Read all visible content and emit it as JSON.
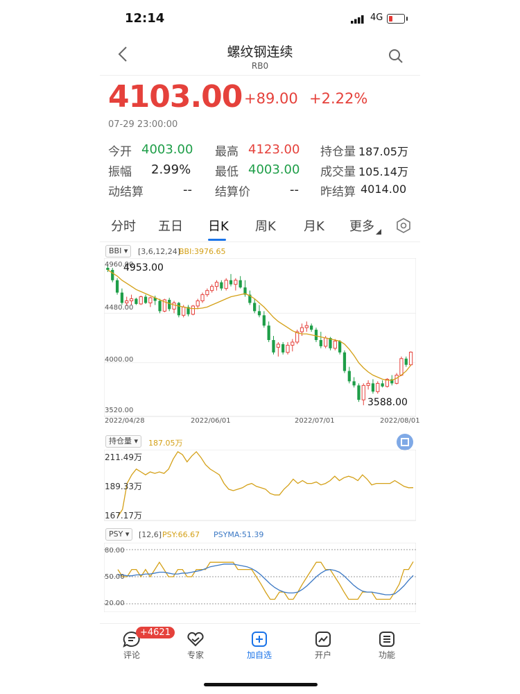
{
  "status_bar": {
    "time": "12:14",
    "network": "4G"
  },
  "header": {
    "title": "螺纹钢连续",
    "code": "RB0"
  },
  "quote": {
    "price": "4103.00",
    "change": "+89.00",
    "change_pct": "+2.22%",
    "timestamp": "07-29 23:00:00"
  },
  "stats": [
    {
      "label": "今开",
      "value": "4003.00",
      "color": "#1e9e48"
    },
    {
      "label": "最高",
      "value": "4123.00",
      "color": "#e5413b"
    },
    {
      "label": "持仓量",
      "value": "187.05万",
      "color": "#222222"
    },
    {
      "label": "振幅",
      "value": "2.99%",
      "color": "#222222"
    },
    {
      "label": "最低",
      "value": "4003.00",
      "color": "#1e9e48"
    },
    {
      "label": "成交量",
      "value": "105.14万",
      "color": "#222222"
    },
    {
      "label": "动结算",
      "value": "--",
      "color": "#222222"
    },
    {
      "label": "结算价",
      "value": "--",
      "color": "#222222"
    },
    {
      "label": "昨结算",
      "value": "4014.00",
      "color": "#222222"
    }
  ],
  "tabs": [
    "分时",
    "五日",
    "日K",
    "周K",
    "月K",
    "更多"
  ],
  "active_tab": "日K",
  "colors": {
    "up": "#e5413b",
    "down": "#1e9e48",
    "bbi": "#d4a017",
    "psyma": "#3b78c4",
    "accent": "#1a73e8"
  },
  "kline": {
    "indicator": "BBI",
    "params": "[3,6,12,24]",
    "indicator_value": "BBI:3976.65",
    "high_label": "4953.00",
    "low_label": "3588.00",
    "y_ticks": [
      "4960.00",
      "4480.00",
      "4000.00",
      "3520.00"
    ],
    "x_ticks": [
      "2022/04/28",
      "2022/06/01",
      "2022/07/01",
      "2022/08/01"
    ]
  },
  "oi_panel": {
    "indicator": "持仓量",
    "value": "187.05万",
    "y_ticks": [
      "211.49万",
      "189.33万",
      "167.17万"
    ]
  },
  "psy_panel": {
    "indicator": "PSY",
    "params": "[12,6]",
    "psy_value": "PSY:66.67",
    "psyma_value": "PSYMA:51.39",
    "y_ticks": [
      "80.00",
      "50.00",
      "20.00"
    ]
  },
  "chart_data": [
    {
      "type": "candlestick",
      "title": "BBI",
      "ylim": [
        3520,
        4960
      ],
      "x_ticks": [
        "2022/04/28",
        "2022/06/01",
        "2022/07/01",
        "2022/08/01"
      ],
      "ohlc": [
        [
          4920,
          4953,
          4880,
          4900
        ],
        [
          4900,
          4920,
          4780,
          4800
        ],
        [
          4800,
          4820,
          4660,
          4680
        ],
        [
          4680,
          4720,
          4560,
          4580
        ],
        [
          4580,
          4640,
          4550,
          4600
        ],
        [
          4600,
          4660,
          4560,
          4620
        ],
        [
          4620,
          4630,
          4560,
          4570
        ],
        [
          4570,
          4650,
          4560,
          4640
        ],
        [
          4640,
          4660,
          4570,
          4580
        ],
        [
          4580,
          4640,
          4540,
          4630
        ],
        [
          4630,
          4650,
          4560,
          4600
        ],
        [
          4600,
          4620,
          4480,
          4500
        ],
        [
          4500,
          4620,
          4490,
          4610
        ],
        [
          4610,
          4630,
          4500,
          4520
        ],
        [
          4520,
          4600,
          4480,
          4580
        ],
        [
          4580,
          4590,
          4440,
          4460
        ],
        [
          4460,
          4560,
          4440,
          4540
        ],
        [
          4540,
          4560,
          4450,
          4470
        ],
        [
          4470,
          4560,
          4460,
          4550
        ],
        [
          4550,
          4620,
          4520,
          4600
        ],
        [
          4600,
          4680,
          4580,
          4660
        ],
        [
          4660,
          4720,
          4640,
          4700
        ],
        [
          4700,
          4760,
          4680,
          4740
        ],
        [
          4740,
          4800,
          4700,
          4780
        ],
        [
          4780,
          4800,
          4700,
          4720
        ],
        [
          4720,
          4820,
          4700,
          4800
        ],
        [
          4800,
          4860,
          4740,
          4760
        ],
        [
          4760,
          4820,
          4700,
          4800
        ],
        [
          4800,
          4840,
          4720,
          4730
        ],
        [
          4730,
          4800,
          4640,
          4660
        ],
        [
          4660,
          4700,
          4560,
          4580
        ],
        [
          4580,
          4620,
          4480,
          4500
        ],
        [
          4500,
          4560,
          4440,
          4460
        ],
        [
          4460,
          4500,
          4340,
          4360
        ],
        [
          4360,
          4400,
          4200,
          4220
        ],
        [
          4220,
          4260,
          4080,
          4100
        ],
        [
          4150,
          4200,
          4060,
          4180
        ],
        [
          4180,
          4200,
          4080,
          4100
        ],
        [
          4100,
          4200,
          4080,
          4170
        ],
        [
          4170,
          4230,
          4110,
          4200
        ],
        [
          4200,
          4320,
          4180,
          4300
        ],
        [
          4300,
          4380,
          4260,
          4340
        ],
        [
          4340,
          4400,
          4300,
          4360
        ],
        [
          4360,
          4380,
          4300,
          4320
        ],
        [
          4320,
          4340,
          4200,
          4220
        ],
        [
          4220,
          4300,
          4140,
          4160
        ],
        [
          4160,
          4260,
          4140,
          4240
        ],
        [
          4240,
          4250,
          4120,
          4140
        ],
        [
          4140,
          4230,
          4120,
          4210
        ],
        [
          4210,
          4220,
          4080,
          4100
        ],
        [
          4100,
          4120,
          3900,
          3920
        ],
        [
          3920,
          3960,
          3800,
          3820
        ],
        [
          3820,
          3860,
          3760,
          3780
        ],
        [
          3780,
          3800,
          3620,
          3640
        ],
        [
          3640,
          3800,
          3588,
          3780
        ],
        [
          3780,
          3830,
          3740,
          3800
        ],
        [
          3800,
          3840,
          3700,
          3720
        ],
        [
          3720,
          3820,
          3700,
          3800
        ],
        [
          3800,
          3830,
          3760,
          3770
        ],
        [
          3770,
          3850,
          3760,
          3840
        ],
        [
          3840,
          3880,
          3780,
          3800
        ],
        [
          3800,
          3900,
          3790,
          3880
        ],
        [
          3880,
          4060,
          3870,
          4040
        ],
        [
          4040,
          4060,
          3960,
          3980
        ],
        [
          3980,
          4110,
          3970,
          4103
        ]
      ],
      "bbi": [
        4900,
        4870,
        4840,
        4800,
        4770,
        4740,
        4710,
        4690,
        4670,
        4650,
        4630,
        4610,
        4590,
        4575,
        4560,
        4550,
        4540,
        4530,
        4525,
        4525,
        4530,
        4540,
        4560,
        4580,
        4600,
        4620,
        4640,
        4650,
        4660,
        4670,
        4650,
        4620,
        4580,
        4540,
        4490,
        4440,
        4400,
        4370,
        4340,
        4310,
        4290,
        4280,
        4280,
        4270,
        4260,
        4250,
        4240,
        4230,
        4220,
        4210,
        4180,
        4130,
        4070,
        4000,
        3950,
        3910,
        3880,
        3860,
        3840,
        3830,
        3830,
        3850,
        3880,
        3920,
        3976.65
      ],
      "high": 4953.0,
      "low": 3588.0
    },
    {
      "type": "line",
      "title": "持仓量",
      "ylim": [
        167.17,
        211.49
      ],
      "series": [
        {
          "name": "持仓量",
          "values": [
            167,
            172,
            190,
            196,
            200,
            198,
            196,
            198,
            197,
            198,
            197,
            200,
            207,
            212,
            210,
            205,
            209,
            212,
            208,
            203,
            200,
            198,
            196,
            190,
            186,
            185,
            186,
            187,
            189,
            190,
            188,
            187,
            186,
            183,
            182,
            182,
            186,
            189,
            193,
            190,
            192,
            190,
            190,
            191,
            189,
            190,
            192,
            195,
            192,
            194,
            195,
            194,
            192,
            196,
            193,
            189,
            190,
            190,
            190,
            190,
            192,
            190,
            188,
            187,
            187.05
          ]
        }
      ]
    },
    {
      "type": "line",
      "title": "PSY",
      "ylim": [
        20,
        80
      ],
      "series": [
        {
          "name": "PSY",
          "values": [
            58,
            50,
            50,
            58,
            58,
            50,
            58,
            50,
            58,
            66,
            58,
            50,
            50,
            58,
            58,
            50,
            50,
            58,
            58,
            58,
            66,
            66,
            66,
            66,
            66,
            66,
            58,
            58,
            58,
            58,
            50,
            42,
            33,
            25,
            25,
            33,
            33,
            25,
            25,
            33,
            42,
            50,
            58,
            66,
            66,
            58,
            58,
            50,
            42,
            33,
            25,
            25,
            25,
            33,
            33,
            33,
            25,
            25,
            25,
            25,
            33,
            42,
            58,
            58,
            66.67
          ]
        },
        {
          "name": "PSYMA",
          "values": [
            52,
            52,
            51,
            51,
            52,
            52,
            53,
            53,
            54,
            55,
            55,
            54,
            53,
            53,
            54,
            54,
            55,
            56,
            57,
            59,
            61,
            62,
            63,
            64,
            64,
            64,
            63,
            62,
            61,
            59,
            56,
            52,
            47,
            42,
            38,
            35,
            33,
            32,
            32,
            33,
            36,
            40,
            45,
            50,
            54,
            57,
            58,
            57,
            55,
            51,
            46,
            41,
            37,
            34,
            33,
            33,
            32,
            31,
            30,
            30,
            31,
            35,
            40,
            46,
            51.39
          ]
        }
      ]
    }
  ],
  "bottom_nav": [
    {
      "label": "评论",
      "icon": "comment-icon"
    },
    {
      "label": "专家",
      "icon": "heart-icon"
    },
    {
      "label": "加自选",
      "icon": "add-watchlist-icon"
    },
    {
      "label": "开户",
      "icon": "chart-up-icon"
    },
    {
      "label": "功能",
      "icon": "menu-icon"
    }
  ],
  "comment_badge": "+4621"
}
